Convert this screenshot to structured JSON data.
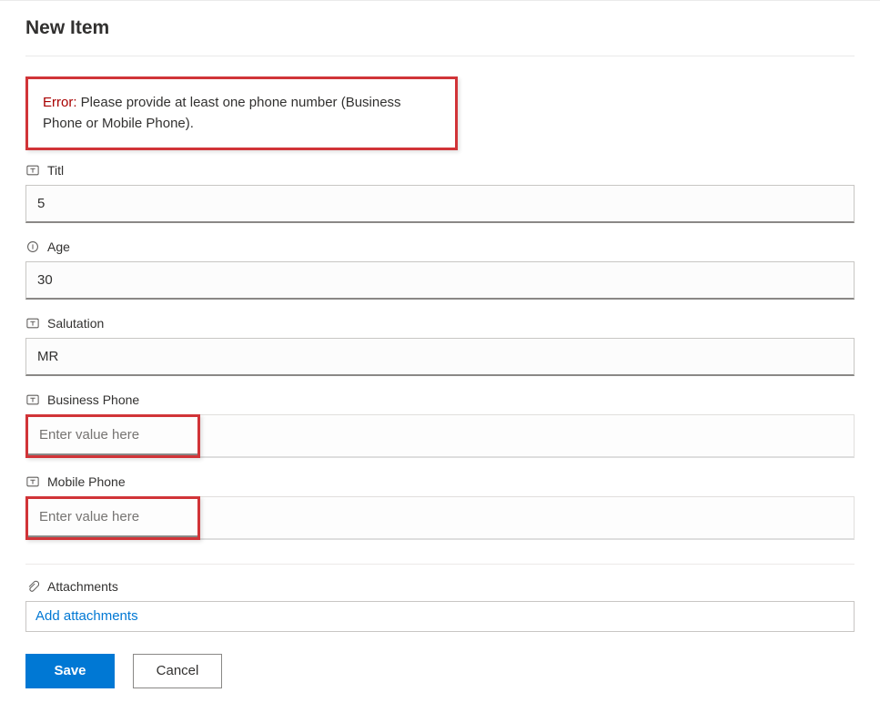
{
  "page_title": "New Item",
  "error": {
    "label": "Error:",
    "message": "Please provide at least one phone number (Business Phone or Mobile Phone)."
  },
  "fields": {
    "title": {
      "label": "Titl",
      "value": "5"
    },
    "age": {
      "label": "Age",
      "value": "30"
    },
    "salutation": {
      "label": "Salutation",
      "value": "MR"
    },
    "business_phone": {
      "label": "Business Phone",
      "placeholder": "Enter value here",
      "value": ""
    },
    "mobile_phone": {
      "label": "Mobile Phone",
      "placeholder": "Enter value here",
      "value": ""
    },
    "attachments": {
      "label": "Attachments",
      "placeholder": "Add attachments"
    }
  },
  "buttons": {
    "save": "Save",
    "cancel": "Cancel"
  }
}
